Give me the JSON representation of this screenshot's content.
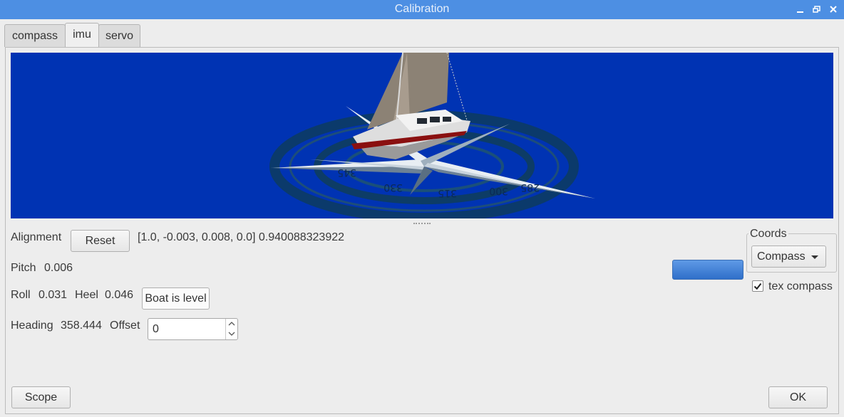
{
  "window": {
    "title": "Calibration"
  },
  "tabs": [
    {
      "label": "compass",
      "active": false
    },
    {
      "label": "imu",
      "active": true
    },
    {
      "label": "servo",
      "active": false
    }
  ],
  "view3d": {
    "background_color": "#0033b3",
    "compass_labels": [
      "345",
      "330",
      "315",
      "300",
      "285"
    ]
  },
  "alignment": {
    "label": "Alignment",
    "reset_label": "Reset",
    "value": "[1.0, -0.003, 0.008, 0.0] 0.940088323922"
  },
  "pitch": {
    "label": "Pitch",
    "value": "0.006"
  },
  "roll": {
    "label": "Roll",
    "value": "0.031"
  },
  "heel": {
    "label": "Heel",
    "value": "0.046",
    "level_button": "Boat is level"
  },
  "heading": {
    "label": "Heading",
    "value": "358.444",
    "offset_label": "Offset",
    "offset_value": "0"
  },
  "progress": {
    "fill": 1.0,
    "color": "#3a7bd5"
  },
  "coords": {
    "group_label": "Coords",
    "selected": "Compass"
  },
  "tex_compass": {
    "label": "tex compass",
    "checked": true
  },
  "footer": {
    "scope_label": "Scope",
    "ok_label": "OK"
  }
}
